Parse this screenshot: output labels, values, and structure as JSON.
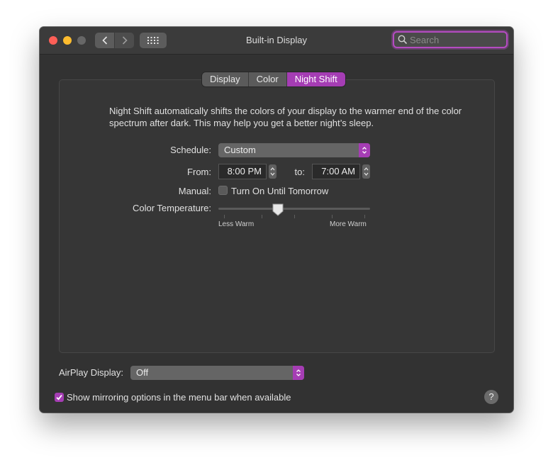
{
  "window": {
    "title": "Built-in Display",
    "search": {
      "placeholder": "Search",
      "value": ""
    }
  },
  "toolbar": {
    "back_icon": "chevron-left-icon",
    "forward_icon": "chevron-right-icon",
    "grid_icon": "grid-icon"
  },
  "tabs": [
    {
      "label": "Display",
      "active": false
    },
    {
      "label": "Color",
      "active": false
    },
    {
      "label": "Night Shift",
      "active": true
    }
  ],
  "night_shift": {
    "description": "Night Shift automatically shifts the colors of your display to the warmer end of the color spectrum after dark. This may help you get a better night’s sleep.",
    "schedule": {
      "label": "Schedule:",
      "value": "Custom"
    },
    "from": {
      "label": "From:",
      "value": "8:00 PM"
    },
    "to": {
      "label": "to:",
      "value": "7:00 AM"
    },
    "manual": {
      "label": "Manual:",
      "checkbox_label": "Turn On Until Tomorrow",
      "checked": false
    },
    "color_temperature": {
      "label": "Color Temperature:",
      "min_label": "Less Warm",
      "max_label": "More Warm",
      "level": 0.4
    }
  },
  "airplay": {
    "label": "AirPlay Display:",
    "value": "Off"
  },
  "mirroring": {
    "label": "Show mirroring options in the menu bar when available",
    "checked": true
  },
  "help_label": "?",
  "colors": {
    "accent": "#a53db4",
    "window_bg": "#323232",
    "titlebar_bg": "#3b3b3b"
  }
}
